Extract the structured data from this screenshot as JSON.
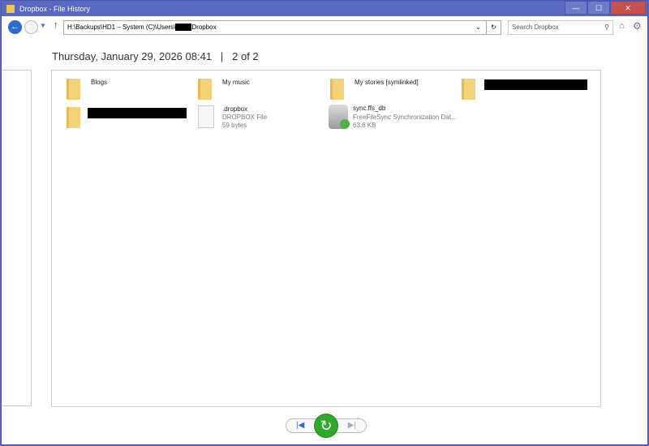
{
  "window": {
    "title": "Dropbox - File History",
    "minimize": "—",
    "maximize": "☐",
    "close": "✕"
  },
  "toolbar": {
    "address_prefix": "H:\\Backups\\HD1 – System (C)\\Users\\",
    "address_suffix": "Dropbox",
    "search_placeholder": "Search Dropbox"
  },
  "header": {
    "date": "Thursday, January 29, 2026 08:41",
    "separator": "|",
    "page": "2 of 2"
  },
  "items": [
    {
      "name": "Blogs",
      "type": "folder"
    },
    {
      "name": "My music",
      "type": "folder"
    },
    {
      "name": "My stories [symlinked]",
      "type": "folder"
    },
    {
      "name": "",
      "type": "folder",
      "redacted": true
    },
    {
      "name": "",
      "type": "folder",
      "redacted": true
    },
    {
      "name": ".dropbox",
      "type": "file",
      "kind": "DROPBOX File",
      "size": "59 bytes"
    },
    {
      "name": "sync.ffs_db",
      "type": "file",
      "kind": "FreeFileSync Synchronization Dat...",
      "size": "63.6 KB"
    }
  ]
}
